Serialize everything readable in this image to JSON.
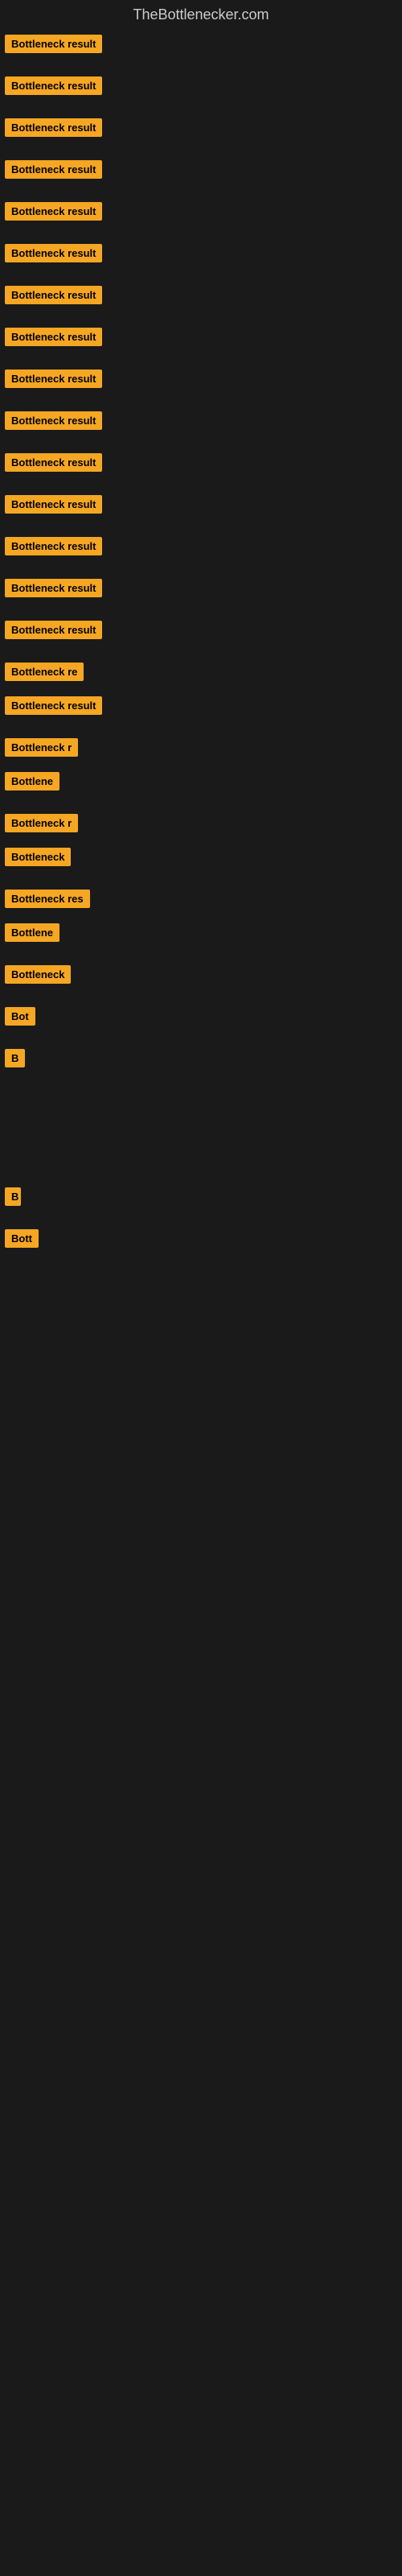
{
  "site": {
    "title": "TheBottlenecker.com"
  },
  "rows": [
    {
      "id": 1,
      "label": "Bottleneck result",
      "size": "full",
      "top_margin": 10
    },
    {
      "id": 2,
      "label": "Bottleneck result",
      "size": "full",
      "top_margin": 20
    },
    {
      "id": 3,
      "label": "Bottleneck result",
      "size": "full",
      "top_margin": 20
    },
    {
      "id": 4,
      "label": "Bottleneck result",
      "size": "full",
      "top_margin": 20
    },
    {
      "id": 5,
      "label": "Bottleneck result",
      "size": "full",
      "top_margin": 20
    },
    {
      "id": 6,
      "label": "Bottleneck result",
      "size": "full",
      "top_margin": 20
    },
    {
      "id": 7,
      "label": "Bottleneck result",
      "size": "full",
      "top_margin": 20
    },
    {
      "id": 8,
      "label": "Bottleneck result",
      "size": "full",
      "top_margin": 20
    },
    {
      "id": 9,
      "label": "Bottleneck result",
      "size": "full",
      "top_margin": 20
    },
    {
      "id": 10,
      "label": "Bottleneck result",
      "size": "full",
      "top_margin": 20
    },
    {
      "id": 11,
      "label": "Bottleneck result",
      "size": "full",
      "top_margin": 20
    },
    {
      "id": 12,
      "label": "Bottleneck result",
      "size": "full",
      "top_margin": 20
    },
    {
      "id": 13,
      "label": "Bottleneck result",
      "size": "full",
      "top_margin": 20
    },
    {
      "id": 14,
      "label": "Bottleneck result",
      "size": "full",
      "top_margin": 20
    },
    {
      "id": 15,
      "label": "Bottleneck result",
      "size": "full",
      "top_margin": 20
    },
    {
      "id": 16,
      "label": "Bottleneck re",
      "size": "partial-1",
      "top_margin": 20
    },
    {
      "id": 17,
      "label": "Bottleneck result",
      "size": "full",
      "top_margin": 10
    },
    {
      "id": 18,
      "label": "Bottleneck r",
      "size": "partial-2",
      "top_margin": 20
    },
    {
      "id": 19,
      "label": "Bottlene",
      "size": "partial-3",
      "top_margin": 10
    },
    {
      "id": 20,
      "label": "Bottleneck r",
      "size": "partial-2",
      "top_margin": 20
    },
    {
      "id": 21,
      "label": "Bottleneck",
      "size": "partial-3",
      "top_margin": 10
    },
    {
      "id": 22,
      "label": "Bottleneck res",
      "size": "partial-1",
      "top_margin": 20
    },
    {
      "id": 23,
      "label": "Bottlene",
      "size": "partial-3",
      "top_margin": 10
    },
    {
      "id": 24,
      "label": "Bottleneck",
      "size": "partial-3",
      "top_margin": 20
    },
    {
      "id": 25,
      "label": "Bot",
      "size": "partial-5",
      "top_margin": 20
    },
    {
      "id": 26,
      "label": "B",
      "size": "partial-7",
      "top_margin": 20
    },
    {
      "id": 27,
      "label": "",
      "size": "spacer",
      "top_margin": 40
    },
    {
      "id": 28,
      "label": "B",
      "size": "partial-8",
      "top_margin": 60
    },
    {
      "id": 29,
      "label": "Bott",
      "size": "partial-6",
      "top_margin": 20
    }
  ]
}
